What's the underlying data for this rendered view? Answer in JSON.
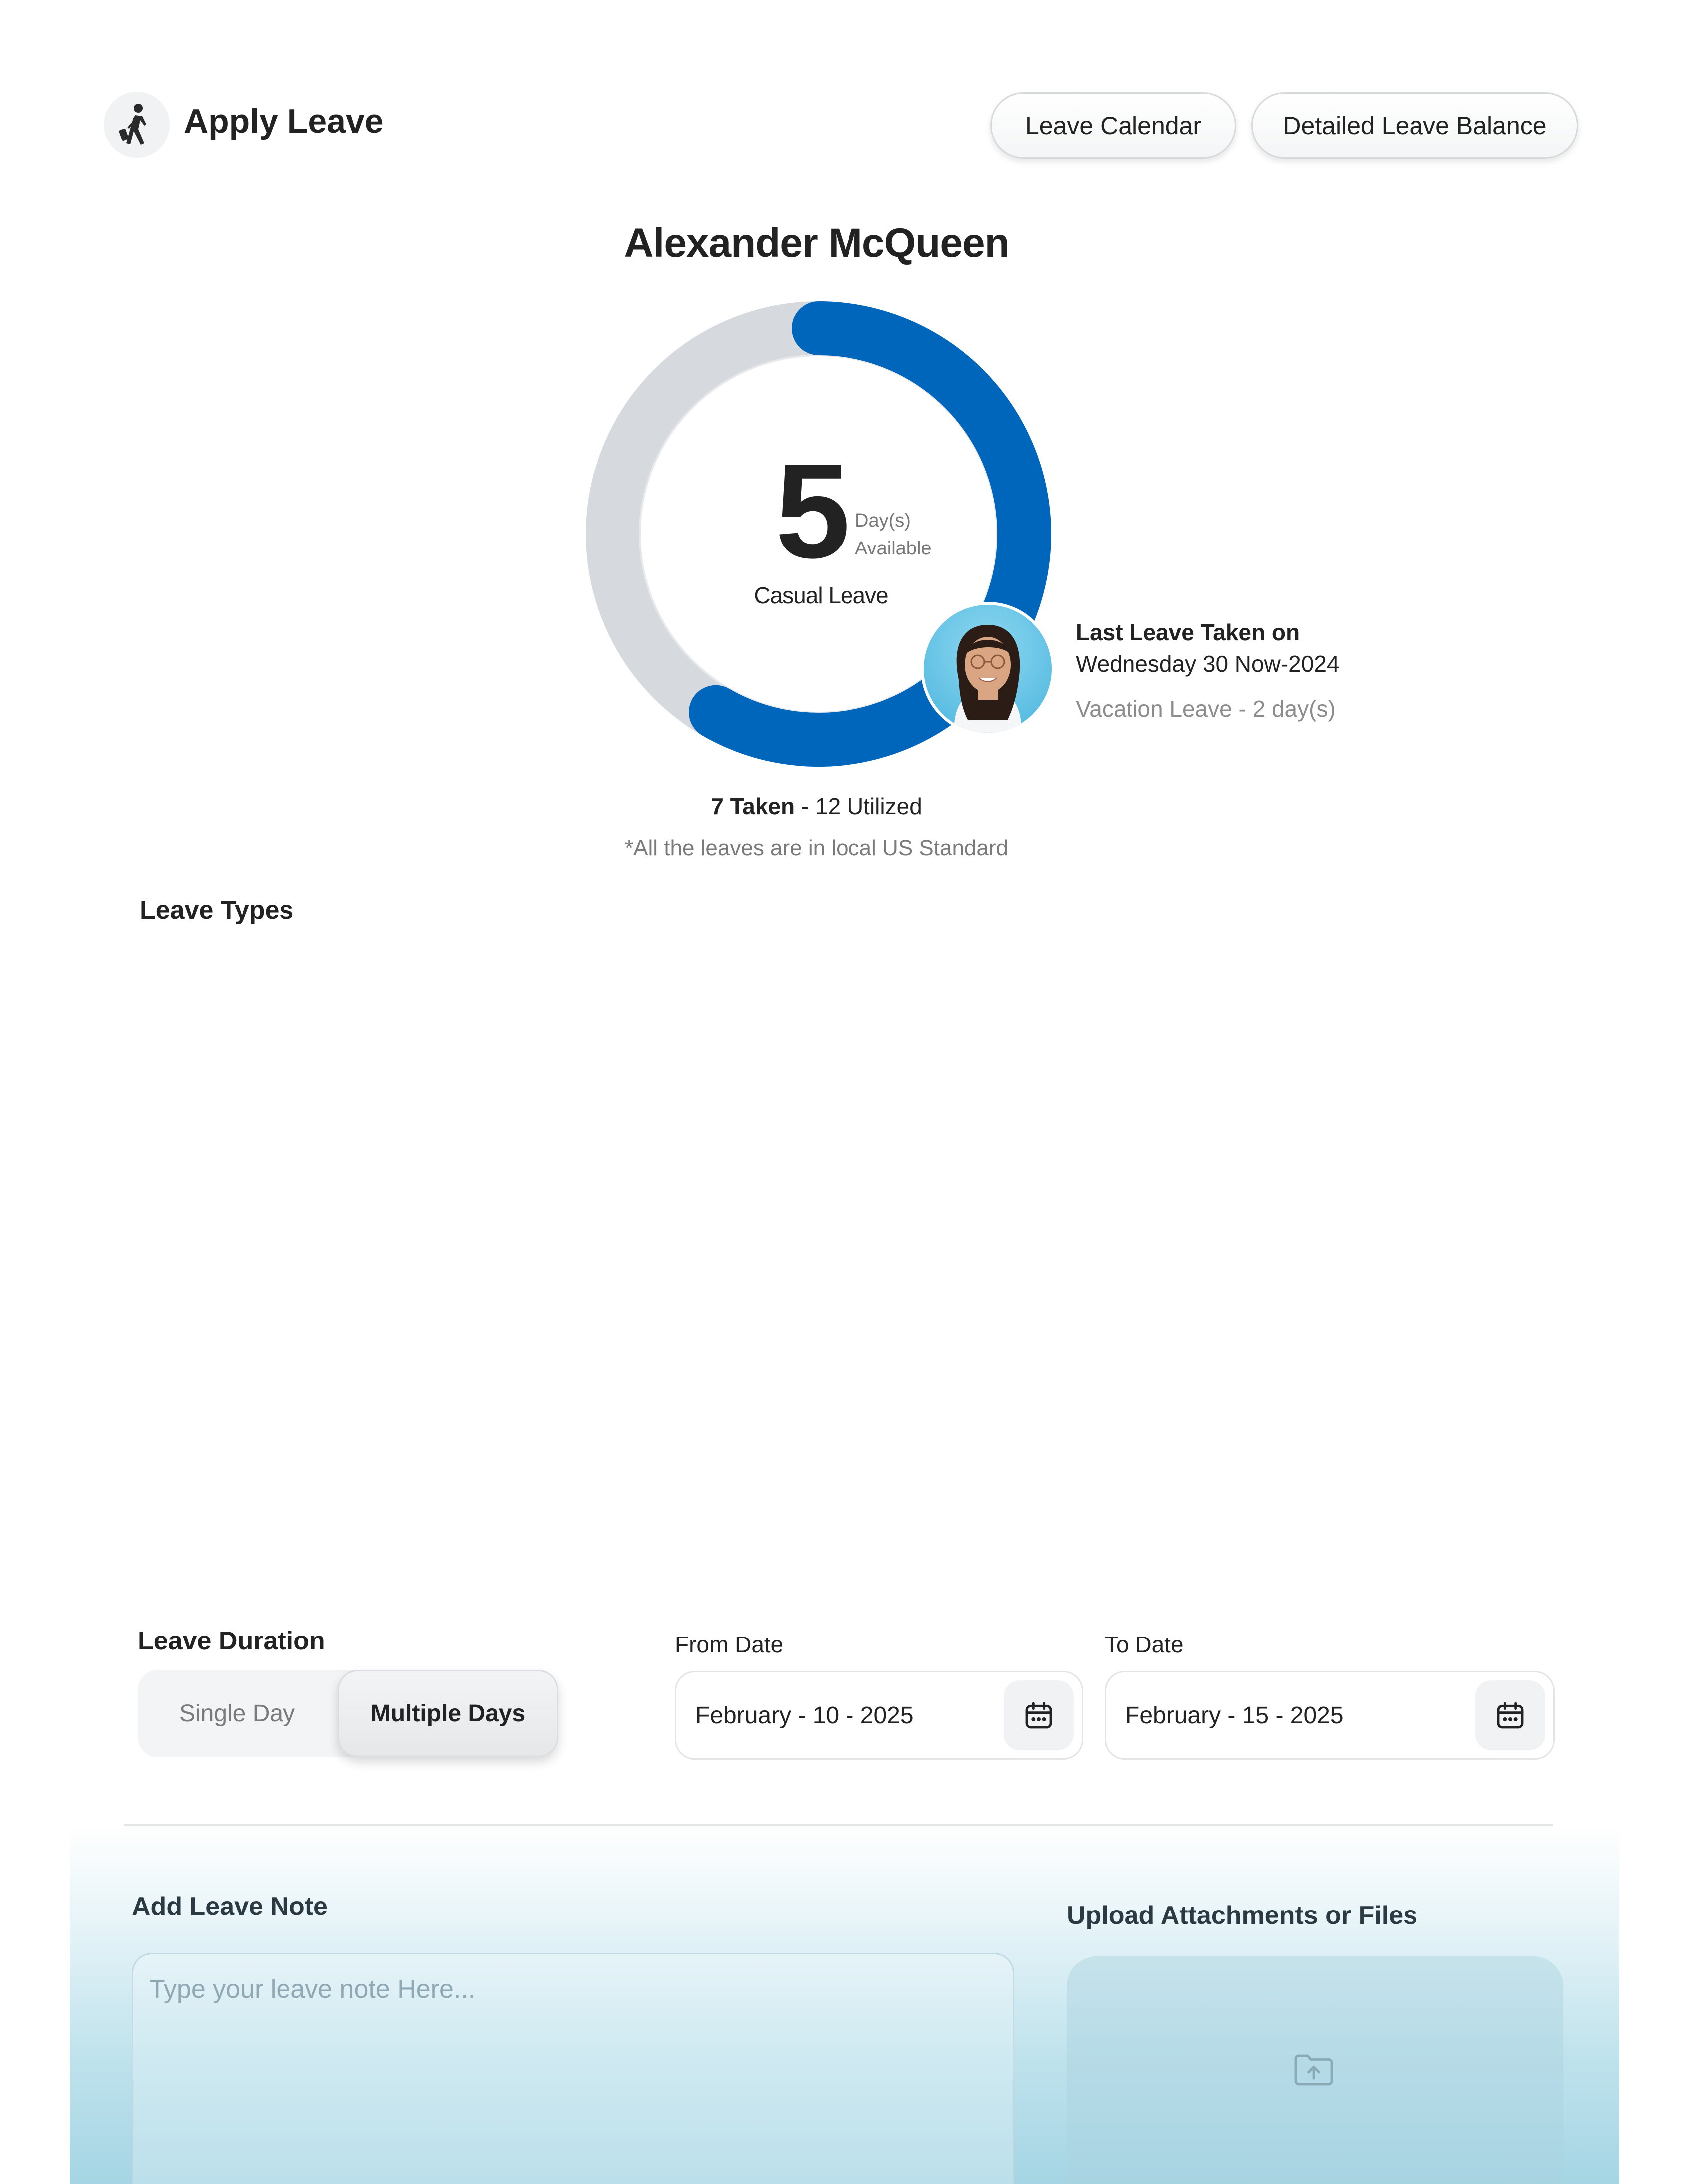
{
  "header": {
    "title": "Apply Leave",
    "buttons": {
      "leave_calendar": "Leave Calendar",
      "detailed_balance": "Detailed Leave Balance"
    }
  },
  "employee": {
    "name": "Alexander McQueen"
  },
  "balance": {
    "available_days": "5",
    "unit_line1": "Day(s)",
    "unit_line2": "Available",
    "leave_type": "Casual Leave",
    "taken_label": "7 Taken",
    "utilized_label": " - 12 Utilized",
    "footnote": "*All the leaves are in local US Standard"
  },
  "chart_data": {
    "type": "donut",
    "values": {
      "taken": 7,
      "total": 12
    },
    "colors": {
      "filled": "#0066bb",
      "track": "#d6d9dd"
    }
  },
  "last_leave": {
    "title": "Last Leave Taken on",
    "date": "Wednesday 30 Now-2024",
    "detail": "Vacation Leave - 2 day(s)"
  },
  "leave_types": {
    "title": "Leave Types"
  },
  "duration": {
    "title": "Leave Duration",
    "options": [
      "Single Day",
      "Multiple Days"
    ],
    "selected": "Multiple Days"
  },
  "dates": {
    "from_label": "From Date",
    "from_value": "February - 10 - 2025",
    "to_label": "To Date",
    "to_value": "February - 15 - 2025"
  },
  "note": {
    "title": "Add Leave Note",
    "placeholder": "Type your leave note Here..."
  },
  "upload": {
    "title": "Upload Attachments or Files"
  },
  "icons": {
    "app": "person-walking-luggage-icon",
    "calendar": "calendar-icon",
    "upload": "folder-upload-icon"
  }
}
